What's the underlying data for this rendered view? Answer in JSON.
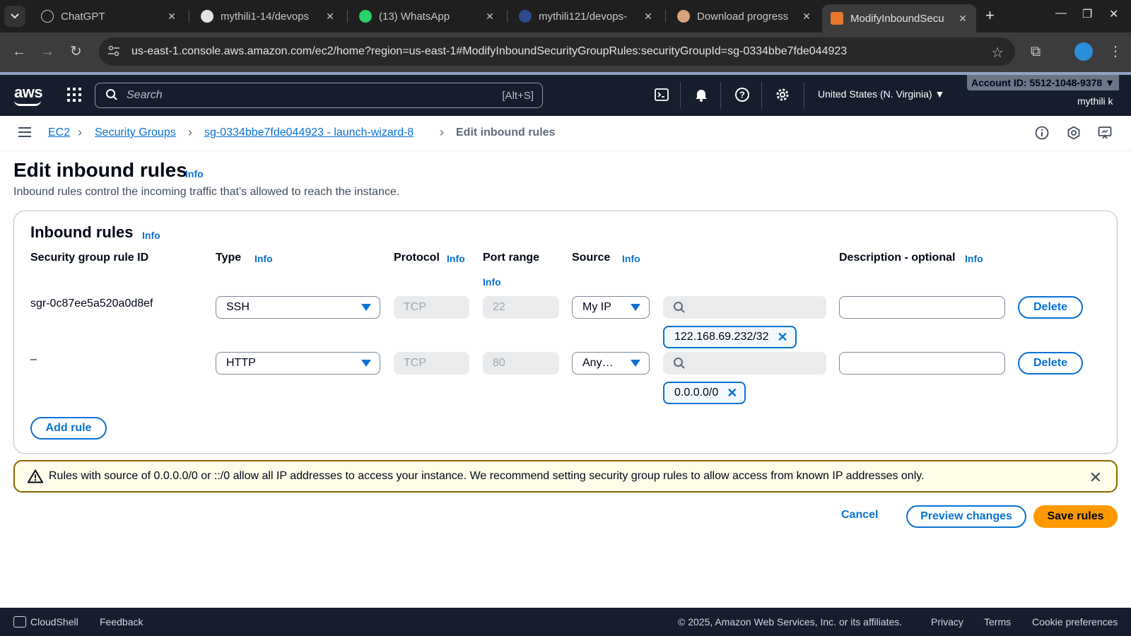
{
  "browser": {
    "tabs": [
      {
        "label": "ChatGPT",
        "icon": "chatgpt-icon"
      },
      {
        "label": "mythili1-14/devops",
        "icon": "github-icon"
      },
      {
        "label": "(13) WhatsApp",
        "icon": "whatsapp-icon"
      },
      {
        "label": "mythili121/devops-",
        "icon": "site-icon"
      },
      {
        "label": "Download progress",
        "icon": "avatar-icon"
      },
      {
        "label": "ModifyInboundSecu",
        "icon": "aws-icon",
        "active": true
      }
    ],
    "url": "us-east-1.console.aws.amazon.com/ec2/home?region=us-east-1#ModifyInboundSecurityGroupRules:securityGroupId=sg-0334bbe7fde044923"
  },
  "aws_nav": {
    "logo": "aws",
    "search_placeholder": "Search",
    "search_shortcut": "[Alt+S]",
    "region": "United States (N. Virginia) ▼",
    "account_id": "Account ID: 5512-1048-9378 ▼",
    "user": "mythili k"
  },
  "breadcrumb": {
    "items": [
      "EC2",
      "Security Groups",
      "sg-0334bbe7fde044923 - launch-wizard-8"
    ],
    "current": "Edit inbound rules"
  },
  "page": {
    "title": "Edit inbound rules",
    "info": "Info",
    "description": "Inbound rules control the incoming traffic that's allowed to reach the instance."
  },
  "panel": {
    "title": "Inbound rules",
    "info": "Info",
    "columns": {
      "rule_id": "Security group rule ID",
      "type": "Type",
      "protocol": "Protocol",
      "port_range": "Port range",
      "source": "Source",
      "description": "Description - optional"
    },
    "rows": [
      {
        "rule_id": "sgr-0c87ee5a520a0d8ef",
        "type": "SSH",
        "protocol": "TCP",
        "port": "22",
        "source": "My IP",
        "token": "122.168.69.232/32",
        "delete": "Delete"
      },
      {
        "rule_id": "–",
        "type": "HTTP",
        "protocol": "TCP",
        "port": "80",
        "source": "Any…",
        "token": "0.0.0.0/0",
        "delete": "Delete"
      }
    ],
    "add_rule": "Add rule"
  },
  "alert": {
    "text": "Rules with source of 0.0.0.0/0 or ::/0 allow all IP addresses to access your instance. We recommend setting security group rules to allow access from known IP addresses only."
  },
  "actions": {
    "cancel": "Cancel",
    "preview": "Preview changes",
    "save": "Save rules"
  },
  "footer": {
    "cloudshell": "CloudShell",
    "feedback": "Feedback",
    "copyright": "© 2025, Amazon Web Services, Inc. or its affiliates.",
    "privacy": "Privacy",
    "terms": "Terms",
    "cookies": "Cookie preferences"
  },
  "colors": {
    "accent": "#0972d3",
    "primary_button": "#ff9900",
    "nav_bg": "#161e2d",
    "warning_border": "#8d6605"
  }
}
